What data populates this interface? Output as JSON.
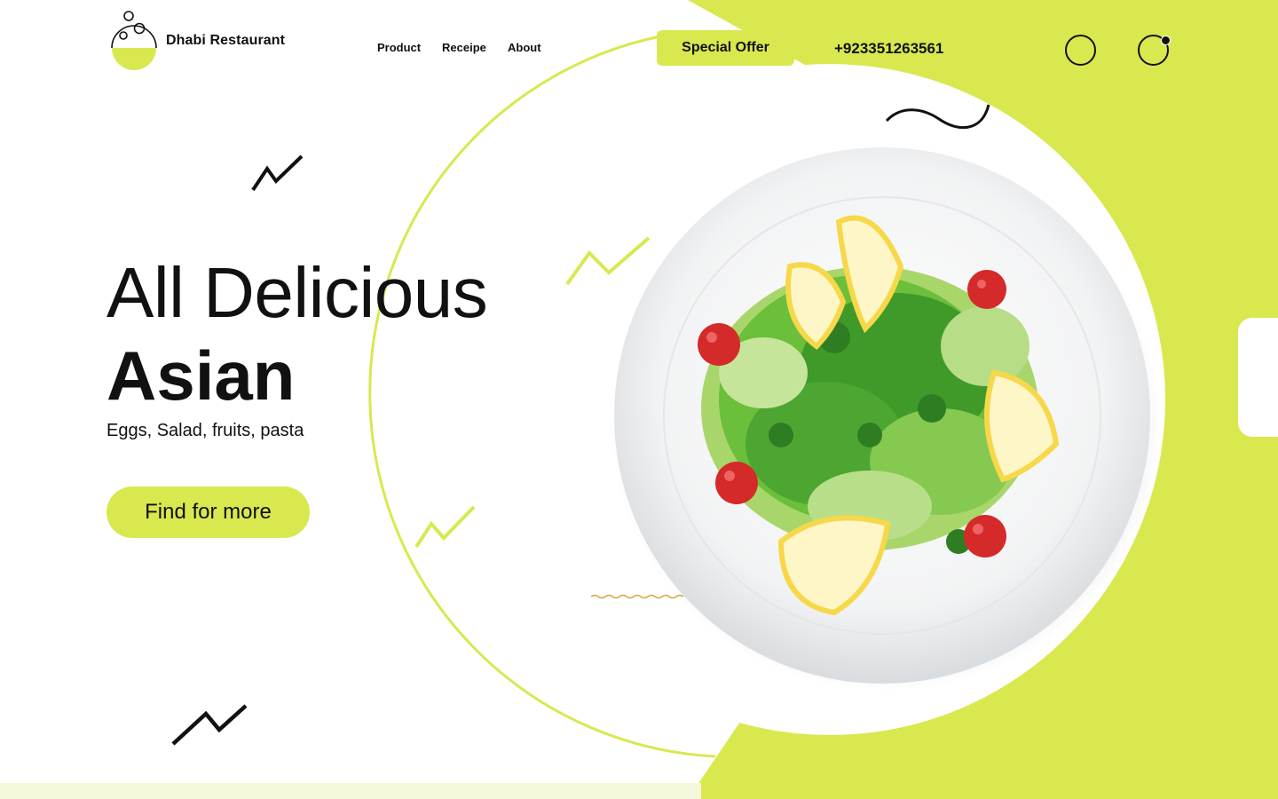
{
  "colors": {
    "accent": "#d9e84f",
    "accent_soft": "#f5f9dc",
    "text": "#111111",
    "background": "#ffffff",
    "tomato": "#d42a2a",
    "lemon": "#f6d84a",
    "greens": "#3f9a2a"
  },
  "header": {
    "brand_name": "Dhabi Restaurant",
    "nav": [
      {
        "label": "Product"
      },
      {
        "label": "Receipe"
      },
      {
        "label": "About"
      }
    ],
    "special_offer_label": "Special Offer",
    "phone": "+923351263561",
    "icons": [
      "search-icon",
      "cart-icon"
    ]
  },
  "hero": {
    "line1": "All Delicious",
    "line2": "Asian",
    "subtitle": "Eggs, Salad, fruits, pasta",
    "cta_label": "Find for more",
    "image": "salad-plate"
  }
}
